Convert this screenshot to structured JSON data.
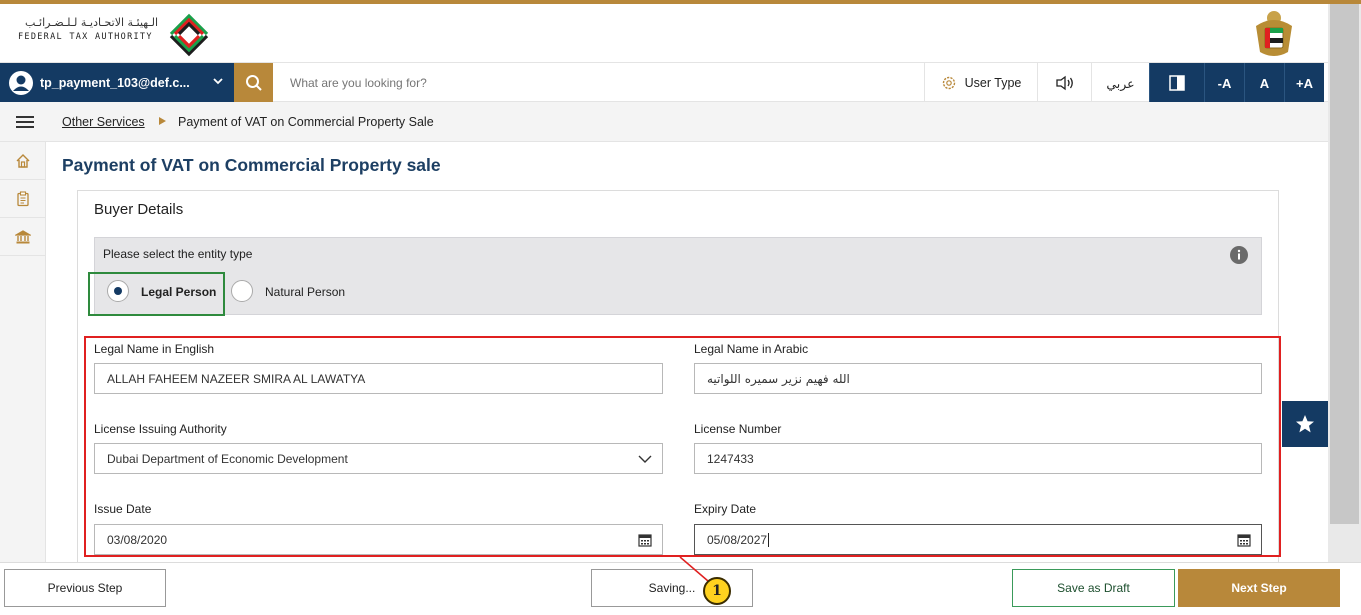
{
  "header": {
    "logo_arabic": "الـهيئـة الاتحـاديـة لـلـضـرائـب",
    "logo_english": "FEDERAL TAX AUTHORITY",
    "logo_icon": "fta-logo-mark",
    "emblem_icon": "uae-emblem"
  },
  "navbar": {
    "user_name": "tp_payment_103@def.c...",
    "search_placeholder": "What are you looking for?",
    "user_type_label": "User Type",
    "audio_icon": "speaker-icon",
    "language_label": "عربي",
    "contrast_icon": "contrast-icon",
    "font_decrease": "-A",
    "font_reset": "A",
    "font_increase": "+A"
  },
  "breadcrumb": {
    "parent": "Other Services",
    "current": "Payment of VAT on Commercial Property Sale"
  },
  "page": {
    "title": "Payment of VAT on Commercial Property sale",
    "section_title": "Buyer Details",
    "entity_prompt": "Please select the entity type",
    "entity_options": [
      {
        "label": "Legal Person",
        "selected": true
      },
      {
        "label": "Natural Person",
        "selected": false
      }
    ]
  },
  "form": {
    "legal_name_en_label": "Legal Name in English",
    "legal_name_en_value": "ALLAH FAHEEM NAZEER SMIRA AL LAWATYA",
    "legal_name_ar_label": "Legal Name in Arabic",
    "legal_name_ar_value": "الله فهيم نزير سميره اللواتيه",
    "license_authority_label": "License Issuing Authority",
    "license_authority_value": "Dubai Department of Economic Development",
    "license_number_label": "License Number",
    "license_number_value": "1247433",
    "issue_date_label": "Issue Date",
    "issue_date_value": "03/08/2020",
    "expiry_date_label": "Expiry Date",
    "expiry_date_value": "05/08/2027"
  },
  "footer": {
    "previous": "Previous Step",
    "saving": "Saving...",
    "save_draft": "Save as Draft",
    "next": "Next Step"
  },
  "callout": {
    "number": "1"
  },
  "colors": {
    "brand_navy": "#143a63",
    "brand_gold": "#b8883a",
    "highlight_red": "#e02020",
    "selected_green": "#2e8a3d",
    "callout_yellow": "#ffd21f"
  }
}
